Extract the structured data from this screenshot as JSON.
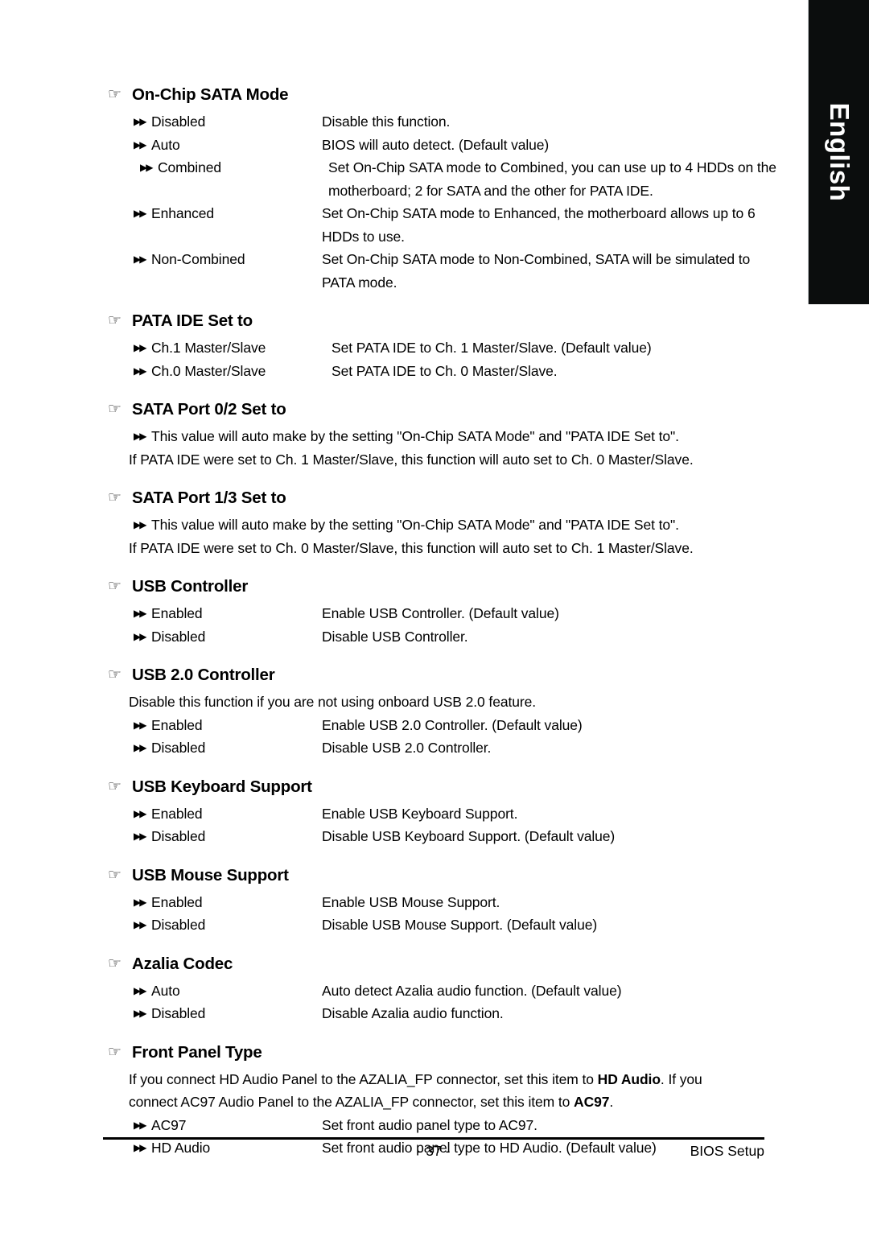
{
  "language_tab": {
    "label": "English"
  },
  "icons": {
    "section_bullet": "☞",
    "option_bullet": "▶▶"
  },
  "sections": [
    {
      "title": "On-Chip SATA Mode",
      "options": [
        {
          "label": "Disabled",
          "desc": "Disable this function."
        },
        {
          "label": "Auto",
          "desc": "BIOS will auto detect.  (Default value)"
        },
        {
          "label": "Combined",
          "desc": "Set On-Chip SATA mode to Combined, you can use up to 4 HDDs on the",
          "desc2": "motherboard; 2 for SATA and the other for PATA IDE."
        },
        {
          "label": "Enhanced",
          "desc": "Set On-Chip SATA mode to Enhanced, the motherboard allows up to 6",
          "desc2": "HDDs to use."
        },
        {
          "label": "Non-Combined",
          "desc": "Set On-Chip SATA mode to Non-Combined, SATA will be simulated to",
          "desc2": "PATA mode."
        }
      ]
    },
    {
      "title": "PATA IDE Set to",
      "options": [
        {
          "label": "Ch.1 Master/Slave",
          "desc": "Set PATA IDE to Ch. 1 Master/Slave. (Default value)"
        },
        {
          "label": "Ch.0 Master/Slave",
          "desc": "Set PATA IDE to Ch. 0 Master/Slave."
        }
      ]
    },
    {
      "title": "SATA Port 0/2 Set to",
      "bullet_paragraph": "This value will auto make by the setting \"On-Chip SATA Mode\" and \"PATA IDE Set to\".",
      "paragraph": "If PATA IDE were set to Ch. 1 Master/Slave, this function will auto set to Ch. 0 Master/Slave."
    },
    {
      "title": "SATA Port 1/3 Set to",
      "bullet_paragraph": "This value will auto make by the setting \"On-Chip SATA Mode\" and \"PATA IDE Set to\".",
      "paragraph": "If PATA IDE were set to Ch. 0 Master/Slave, this function will auto set to Ch. 1 Master/Slave."
    },
    {
      "title": "USB Controller",
      "options": [
        {
          "label": "Enabled",
          "desc": "Enable USB Controller. (Default value)"
        },
        {
          "label": "Disabled",
          "desc": "Disable USB Controller."
        }
      ]
    },
    {
      "title": "USB 2.0 Controller",
      "intro": "Disable this function if you are not using onboard USB 2.0 feature.",
      "options": [
        {
          "label": "Enabled",
          "desc": "Enable USB 2.0 Controller. (Default value)"
        },
        {
          "label": "Disabled",
          "desc": "Disable USB 2.0 Controller."
        }
      ]
    },
    {
      "title": "USB Keyboard Support",
      "options": [
        {
          "label": "Enabled",
          "desc": "Enable USB Keyboard Support."
        },
        {
          "label": "Disabled",
          "desc": "Disable USB Keyboard Support. (Default value)"
        }
      ]
    },
    {
      "title": "USB Mouse Support",
      "options": [
        {
          "label": "Enabled",
          "desc": "Enable USB Mouse Support."
        },
        {
          "label": "Disabled",
          "desc": "Disable USB Mouse Support. (Default value)"
        }
      ]
    },
    {
      "title": "Azalia Codec",
      "options": [
        {
          "label": "Auto",
          "desc": "Auto detect Azalia audio function. (Default value)"
        },
        {
          "label": "Disabled",
          "desc": "Disable Azalia audio function."
        }
      ]
    },
    {
      "title": "Front Panel Type",
      "intro_rich": {
        "line1_a": "If you connect HD Audio Panel to the AZALIA_FP connector, set this item to ",
        "line1_bold": "HD Audio",
        "line1_b": ". If you",
        "line2_a": "connect AC97 Audio Panel to the AZALIA_FP connector, set this item to ",
        "line2_bold": "AC97",
        "line2_b": "."
      },
      "options": [
        {
          "label": "AC97",
          "desc": "Set front audio panel type to AC97."
        },
        {
          "label": "HD Audio",
          "desc": "Set front audio panel type to HD Audio. (Default value)"
        }
      ]
    }
  ],
  "footer": {
    "page_number": "- 37 -",
    "label": "BIOS Setup"
  }
}
